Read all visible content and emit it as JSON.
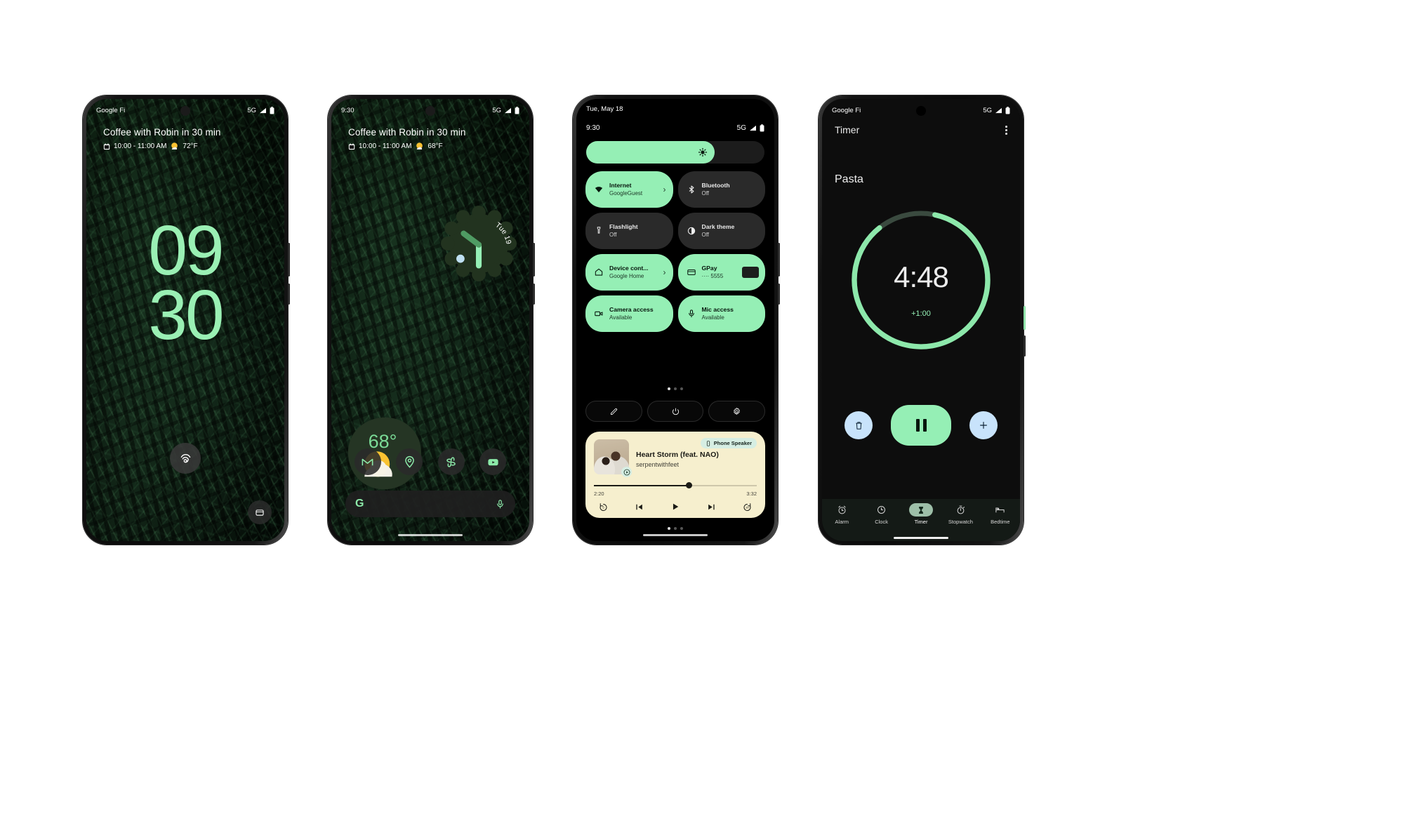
{
  "accent": {
    "mint": "#95efb5",
    "cream": "#f6efce",
    "chip": "#d6eee3",
    "blue": "#c8e3fb",
    "dark_green": "#2b3a2b"
  },
  "phone1": {
    "status": {
      "carrier": "Google Fi",
      "network": "5G"
    },
    "smartspace": {
      "title": "Coffee with Robin in 30 min",
      "time_range": "10:00 - 11:00 AM",
      "temp": "72°F"
    },
    "clock": {
      "hours": "09",
      "minutes": "30"
    },
    "fingerprint_label": "fingerprint-unlock",
    "wallet_label": "wallet"
  },
  "phone2": {
    "status": {
      "time": "9:30",
      "network": "5G"
    },
    "smartspace": {
      "title": "Coffee with Robin in 30 min",
      "time_range": "10:00 - 11:00 AM",
      "temp": "68°F"
    },
    "clock_widget": {
      "date": "Tue 19"
    },
    "weather_widget": {
      "temp": "68°"
    },
    "dock": [
      {
        "name": "gmail",
        "label": "Gmail"
      },
      {
        "name": "maps",
        "label": "Maps"
      },
      {
        "name": "photos",
        "label": "Photos"
      },
      {
        "name": "youtube",
        "label": "YouTube"
      }
    ],
    "search": {
      "logo": "G",
      "mic": "mic-icon"
    }
  },
  "phone3": {
    "date": "Tue, May 18",
    "status": {
      "time": "9:30",
      "network": "5G"
    },
    "brightness": {
      "level": 72,
      "icon": "brightness-icon"
    },
    "tiles": [
      {
        "label": "Internet",
        "sub": "GoogleGuest",
        "state": "on",
        "icon": "wifi-icon",
        "chevron": true
      },
      {
        "label": "Bluetooth",
        "sub": "Off",
        "state": "off",
        "icon": "bluetooth-icon",
        "chevron": false
      },
      {
        "label": "Flashlight",
        "sub": "Off",
        "state": "off",
        "icon": "flashlight-icon",
        "chevron": false
      },
      {
        "label": "Dark theme",
        "sub": "Off",
        "state": "off",
        "icon": "contrast-icon",
        "chevron": false
      },
      {
        "label": "Device cont...",
        "sub": "Google Home",
        "state": "on",
        "icon": "home-icon",
        "chevron": true
      },
      {
        "label": "GPay",
        "sub": "···· 5555",
        "state": "on",
        "icon": "credit-card-icon",
        "chevron": false
      },
      {
        "label": "Camera access",
        "sub": "Available",
        "state": "on",
        "icon": "camera-icon",
        "chevron": false
      },
      {
        "label": "Mic access",
        "sub": "Available",
        "state": "on",
        "icon": "mic-icon",
        "chevron": false
      }
    ],
    "actions": [
      {
        "name": "edit-button",
        "icon": "pencil-icon"
      },
      {
        "name": "power-button",
        "icon": "power-icon"
      },
      {
        "name": "settings-button",
        "icon": "gear-icon"
      }
    ],
    "media": {
      "output_chip": "Phone Speaker",
      "title": "Heart Storm (feat. NAO)",
      "artist": "serpentwithfeet",
      "elapsed": "2:20",
      "duration": "3:32",
      "progress_pct": 58,
      "controls": [
        {
          "name": "rewind-5-button",
          "label": "5"
        },
        {
          "name": "previous-button",
          "label": ""
        },
        {
          "name": "play-button",
          "label": ""
        },
        {
          "name": "next-button",
          "label": ""
        },
        {
          "name": "forward-30-button",
          "label": "30"
        }
      ]
    }
  },
  "phone4": {
    "status": {
      "carrier": "Google Fi",
      "network": "5G"
    },
    "header": {
      "title": "Timer"
    },
    "timer": {
      "label": "Pasta",
      "remaining": "4:48",
      "add_minute": "+1:00",
      "progress_pct": 86
    },
    "controls": [
      {
        "name": "delete-timer-button",
        "icon": "trash-icon"
      },
      {
        "name": "pause-timer-button",
        "icon": "pause-icon"
      },
      {
        "name": "add-timer-button",
        "icon": "plus-icon"
      }
    ],
    "nav": [
      {
        "label": "Alarm",
        "icon": "alarm-icon",
        "active": false
      },
      {
        "label": "Clock",
        "icon": "clock-icon",
        "active": false
      },
      {
        "label": "Timer",
        "icon": "hourglass-icon",
        "active": true
      },
      {
        "label": "Stopwatch",
        "icon": "stopwatch-icon",
        "active": false
      },
      {
        "label": "Bedtime",
        "icon": "bed-icon",
        "active": false
      }
    ]
  }
}
